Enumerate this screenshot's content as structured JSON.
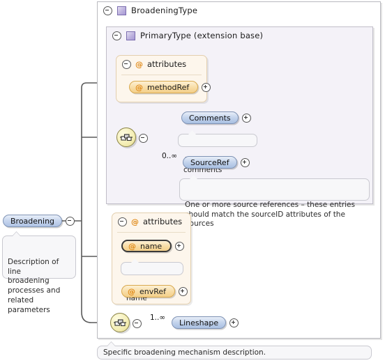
{
  "diagram": {
    "kind": "xml-schema-diagram",
    "root_element": {
      "name": "Broadening",
      "toggle": "minus"
    },
    "root_documentation": "Description of line\nbroadening\nprocesses and\nrelated parameters",
    "caption": "Specific broadening mechanism description.",
    "types": {
      "outer": {
        "name": "BroadeningType",
        "toggle": "minus",
        "icon": "complex-type-icon"
      },
      "inner": {
        "name": "PrimaryType (extension base)",
        "toggle": "minus",
        "icon": "complex-type-icon"
      }
    },
    "attribute_groups": [
      {
        "id": "primary-attributes",
        "label": "attributes",
        "toggle": "minus",
        "icon": "attribute-icon",
        "attributes": [
          {
            "name": "methodRef",
            "required": false,
            "toggle": "plus",
            "documentation": ""
          }
        ]
      },
      {
        "id": "broadening-attributes",
        "label": "attributes",
        "toggle": "minus",
        "icon": "attribute-icon",
        "attributes": [
          {
            "name": "name",
            "required": true,
            "toggle": "plus",
            "documentation": "Broadening name"
          },
          {
            "name": "envRef",
            "required": false,
            "toggle": "plus",
            "documentation": ""
          }
        ]
      }
    ],
    "compositors": [
      {
        "id": "primary-sequence",
        "icon": "sequence-icon",
        "toggle": "minus",
        "children": [
          {
            "name": "Comments",
            "toggle": "plus",
            "cardinality": "",
            "documentation": "Arbitrary comments"
          },
          {
            "name": "SourceRef",
            "toggle": "plus",
            "cardinality": "0..∞",
            "documentation": "One or more source references – these entries\nshould match the sourceID attributes of the Sources"
          }
        ]
      },
      {
        "id": "broadening-sequence",
        "icon": "sequence-icon",
        "toggle": "minus",
        "children": [
          {
            "name": "Lineshape",
            "toggle": "plus",
            "cardinality": "1..∞",
            "documentation": ""
          }
        ]
      }
    ],
    "colors": {
      "element_fill": "#c3d3ec",
      "attribute_fill": "#f8dca4",
      "compositor_fill": "#f5efb8",
      "inner_type_bg": "#f4f2f8",
      "attr_panel_bg": "#fdf6ec",
      "doc_bg": "#f7f7f9",
      "connector": "#5a5a5a"
    }
  }
}
